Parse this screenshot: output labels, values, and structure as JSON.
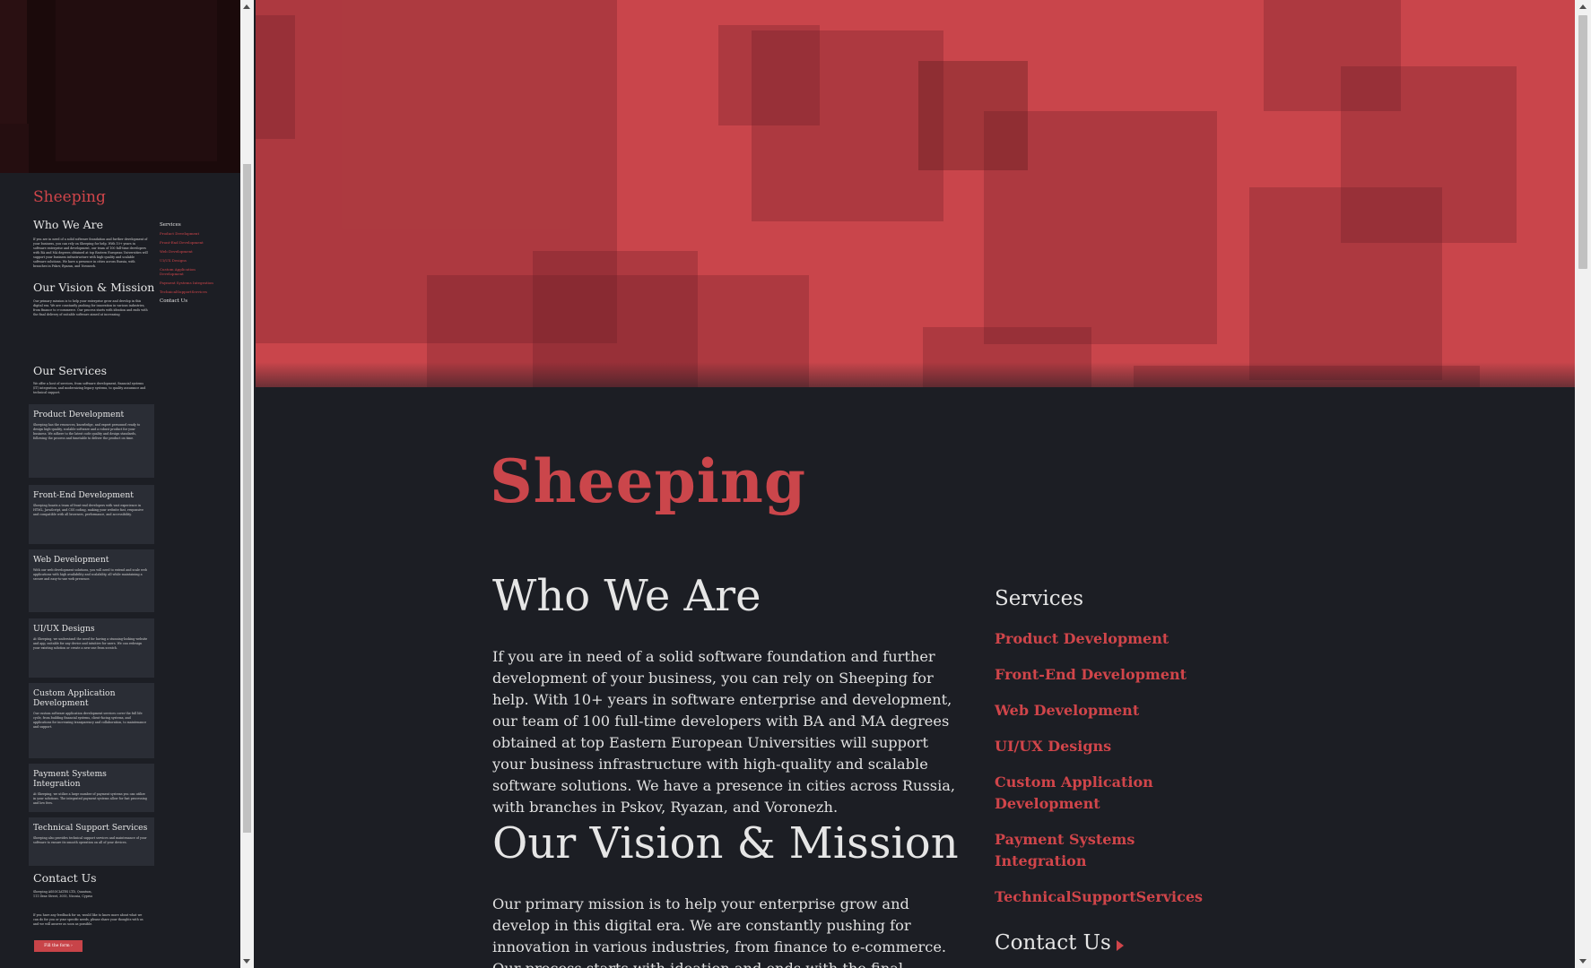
{
  "site": {
    "logo": "Sheeping",
    "colors": {
      "accent": "#cb464b",
      "hero": "#c9454b",
      "background": "#1c1e24",
      "text": "#e6e6e6"
    }
  },
  "who_we_are": {
    "heading": "Who We Are",
    "text": "If you are in need of a solid software foundation and further development of your business, you can rely on Sheeping for help. With 10+ years in software enterprise and development, our team of 100 full-time developers with BA and MA degrees obtained at top Eastern European Universities will support your business infrastructure with high-quality and scalable software solutions. We have a presence in cities across Russia, with branches in Pskov, Ryazan, and Voronezh."
  },
  "vision": {
    "heading": "Our Vision & Mission",
    "text": "Our primary mission is to help your enterprise grow and develop in this digital era. We are constantly pushing for innovation in various industries, from finance to e-commerce. Our process starts with ideation and ends with the final delivery of suitable software aimed at increasing"
  },
  "sidebar": {
    "heading": "Services",
    "links": [
      "Product Development",
      "Front-End Development",
      "Web Development",
      "UI/UX Designs",
      "Custom Application Development",
      "Payment Systems Integration",
      "TechnicalSupportServices"
    ],
    "contact": "Contact Us"
  },
  "preview": {
    "logo": "Sheeping",
    "who_heading": "Who We Are",
    "vision_heading": "Our Vision & Mission",
    "services_heading": "Our Services",
    "services_text": "We offer a host of services, from software development, financial systems (IT) integration, and modernizing legacy systems, to quality assurance and technical support.",
    "cards": [
      {
        "title": "Product Development",
        "text": "Sheeping has the resources, knowledge, and expert personnel ready to design high-quality, scalable software and a robust product for your business. We adhere to the latest code quality and design standards, following the process and timetable to deliver the product on time."
      },
      {
        "title": "Front-End Development",
        "text": "Sheeping boasts a team of front-end developers with vast experience in HTML, JavaScript, and CSS coding, making your website fast, responsive and compatible with all browsers, performance, and accessibility."
      },
      {
        "title": "Web Development",
        "text": "With our web development solutions, you will need to extend and scale web applications with high availability and scalability, all while maintaining a secure and easy-to-use web presence."
      },
      {
        "title": "UI/UX Designs",
        "text": "At Sheeping, we understand the need for having a stunning-looking website and app, suitable for any device and intuitive for users. We can redesign your existing solution or create a new one from scratch."
      },
      {
        "title": "Custom Application Development",
        "text": "Our custom software application development services cover the full life cycle, from building financial systems, client-facing systems, and applications for increasing transparency and collaboration, to maintenance and support."
      },
      {
        "title": "Payment Systems Integration",
        "text": "At Sheeping, we utilize a large number of payment systems you can utilize in your solutions. The integrated payment systems allow for fast processing and low fees."
      },
      {
        "title": "Technical Support Services",
        "text": "Sheeping also provides technical support services and maintenance of your software to ensure its smooth operation on all of your devices."
      }
    ],
    "contact_heading": "Contact Us",
    "contact_address": "Sheeping ASSOCIATES LTD, Quantum, 111 Ilene Street, 3055, Nicosia, Cyprus",
    "contact_text": "If you have any feedback for us, would like to know more about what we can do for you or your specific needs, please share your thoughts with us and we will answer as soon as possible.",
    "button": "Fill the form ›"
  }
}
